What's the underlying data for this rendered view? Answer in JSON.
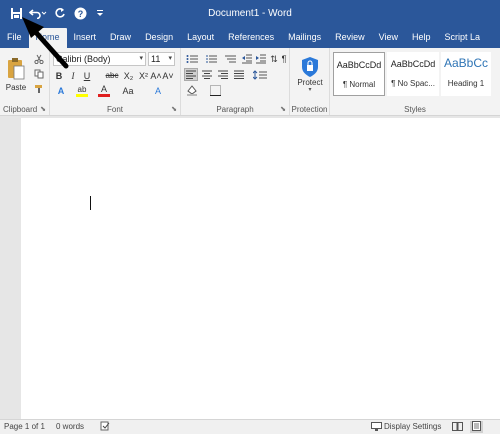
{
  "window": {
    "title": "Document1 - Word"
  },
  "qat": {
    "customize": "≡"
  },
  "tabs": [
    {
      "label": "File"
    },
    {
      "label": "Home"
    },
    {
      "label": "Insert"
    },
    {
      "label": "Draw"
    },
    {
      "label": "Design"
    },
    {
      "label": "Layout"
    },
    {
      "label": "References"
    },
    {
      "label": "Mailings"
    },
    {
      "label": "Review"
    },
    {
      "label": "View"
    },
    {
      "label": "Help"
    },
    {
      "label": "Script La"
    }
  ],
  "clipboard": {
    "paste_label": "Paste",
    "group_label": "Clipboard"
  },
  "font": {
    "name": "Calibri (Body)",
    "size": "11",
    "bold": "B",
    "italic": "I",
    "underline": "U",
    "strike": "abc",
    "subscript": "X₂",
    "superscript": "X²",
    "grow": "A˄",
    "shrink": "A˅",
    "case": "Aa",
    "clear": "A",
    "effects": "A",
    "highlight": "ab",
    "color": "A",
    "group_label": "Font"
  },
  "paragraph": {
    "group_label": "Paragraph",
    "show_marks": "¶",
    "sort": "⇅"
  },
  "protection": {
    "protect_label": "Protect",
    "group_label": "Protection"
  },
  "styles": {
    "items": [
      {
        "sample": "AaBbCcDd",
        "name": "¶ Normal"
      },
      {
        "sample": "AaBbCcDd",
        "name": "¶ No Spac..."
      },
      {
        "sample": "AaBbCc",
        "name": "Heading 1"
      }
    ],
    "group_label": "Styles"
  },
  "statusbar": {
    "page": "Page 1 of 1",
    "words": "0 words",
    "display_settings": "Display Settings"
  },
  "colors": {
    "accent": "#2b579a",
    "highlight": "#ffff00",
    "font_color": "#e02020"
  }
}
